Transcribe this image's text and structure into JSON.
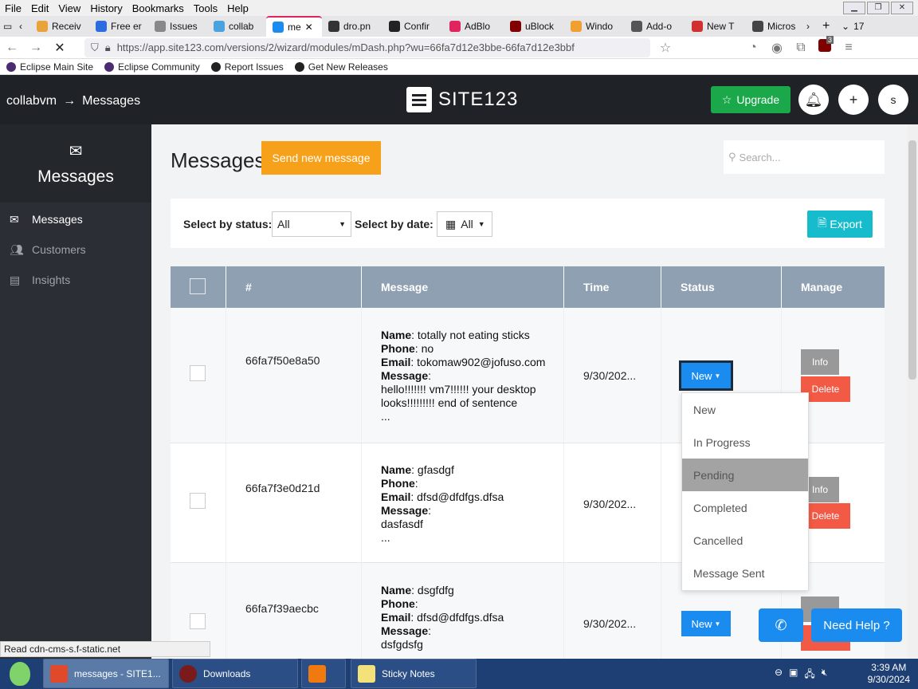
{
  "browser": {
    "menu": [
      "File",
      "Edit",
      "View",
      "History",
      "Bookmarks",
      "Tools",
      "Help"
    ],
    "tabs": [
      {
        "label": "Receiv",
        "color": "#e8a33a"
      },
      {
        "label": "Free er",
        "color": "#2d6cdf"
      },
      {
        "label": "Issues",
        "color": "#888888"
      },
      {
        "label": "collab",
        "color": "#4aa3df"
      },
      {
        "label": "me",
        "color": "#1a8cf0",
        "active": true
      },
      {
        "label": "dro.pn",
        "color": "#333333"
      },
      {
        "label": "Confir",
        "color": "#222222"
      },
      {
        "label": "AdBlo",
        "color": "#e0245e"
      },
      {
        "label": "uBlock",
        "color": "#800000"
      },
      {
        "label": "Windo",
        "color": "#f0a030"
      },
      {
        "label": "Add-o",
        "color": "#555555"
      },
      {
        "label": "New T",
        "color": "#d03030"
      },
      {
        "label": "Micros",
        "color": "#444444"
      }
    ],
    "tab_count": "17",
    "url": "https://app.site123.com/versions/2/wizard/modules/mDash.php?wu=66fa7d12e3bbe-66fa7d12e3bbf",
    "bookmarks": [
      "Eclipse Main Site",
      "Eclipse Community",
      "Report Issues",
      "Get New Releases"
    ],
    "status_line": "Read cdn-cms-s.f-static.net",
    "ext_badge": "3"
  },
  "header": {
    "breadcrumb_site": "collabvm",
    "breadcrumb_arrow": "→",
    "breadcrumb_page": "Messages",
    "logo": "SITE123",
    "upgrade": "Upgrade",
    "avatar": "s"
  },
  "sidebar": {
    "title": "Messages",
    "items": [
      {
        "label": "Messages",
        "icon": "envelope-icon"
      },
      {
        "label": "Customers",
        "icon": "users-icon"
      },
      {
        "label": "Insights",
        "icon": "chart-icon"
      }
    ]
  },
  "main": {
    "title": "Messages",
    "send_button": "Send new message",
    "search_placeholder": "Search...",
    "filter_status_label": "Select by status:",
    "filter_status_value": "All",
    "filter_date_label": "Select by date:",
    "filter_date_value": "All",
    "export": "Export",
    "columns": [
      "#",
      "Message",
      "Time",
      "Status",
      "Manage"
    ],
    "rows": [
      {
        "id": "66fa7f50e8a50",
        "name": "totally not eating sticks",
        "phone": "no",
        "email": "tokomaw902@jofuso.com",
        "message": "hello!!!!!!! vm7!!!!!! your desktop looks!!!!!!!!! end of sentence",
        "ellipsis": "...",
        "time": "9/30/202...",
        "status": "New",
        "info": "Info",
        "delete": "Delete"
      },
      {
        "id": "66fa7f3e0d21d",
        "name": "gfasdgf",
        "phone": "",
        "email": "dfsd@dfdfgs.dfsa",
        "message": "dasfasdf",
        "ellipsis": "...",
        "time": "9/30/202...",
        "status": "",
        "info": "Info",
        "delete": "Delete"
      },
      {
        "id": "66fa7f39aecbc",
        "name": "dsgfdfg",
        "phone": "",
        "email": "dfsd@dfdfgs.dfsa",
        "message": "dsfgdsfg",
        "ellipsis": "",
        "time": "9/30/202...",
        "status": "New",
        "info": "",
        "delete": "Delete"
      }
    ],
    "field_labels": {
      "name": "Name",
      "phone": "Phone",
      "email": "Email",
      "message": "Message"
    },
    "status_options": [
      "New",
      "In Progress",
      "Pending",
      "Completed",
      "Cancelled",
      "Message Sent"
    ],
    "highlighted_option": "Pending"
  },
  "floating": {
    "help": "Need Help ?"
  },
  "taskbar": {
    "items": [
      "messages - SITE1...",
      "Downloads",
      "",
      "Sticky Notes"
    ],
    "time": "3:39 AM",
    "date": "9/30/2024"
  }
}
